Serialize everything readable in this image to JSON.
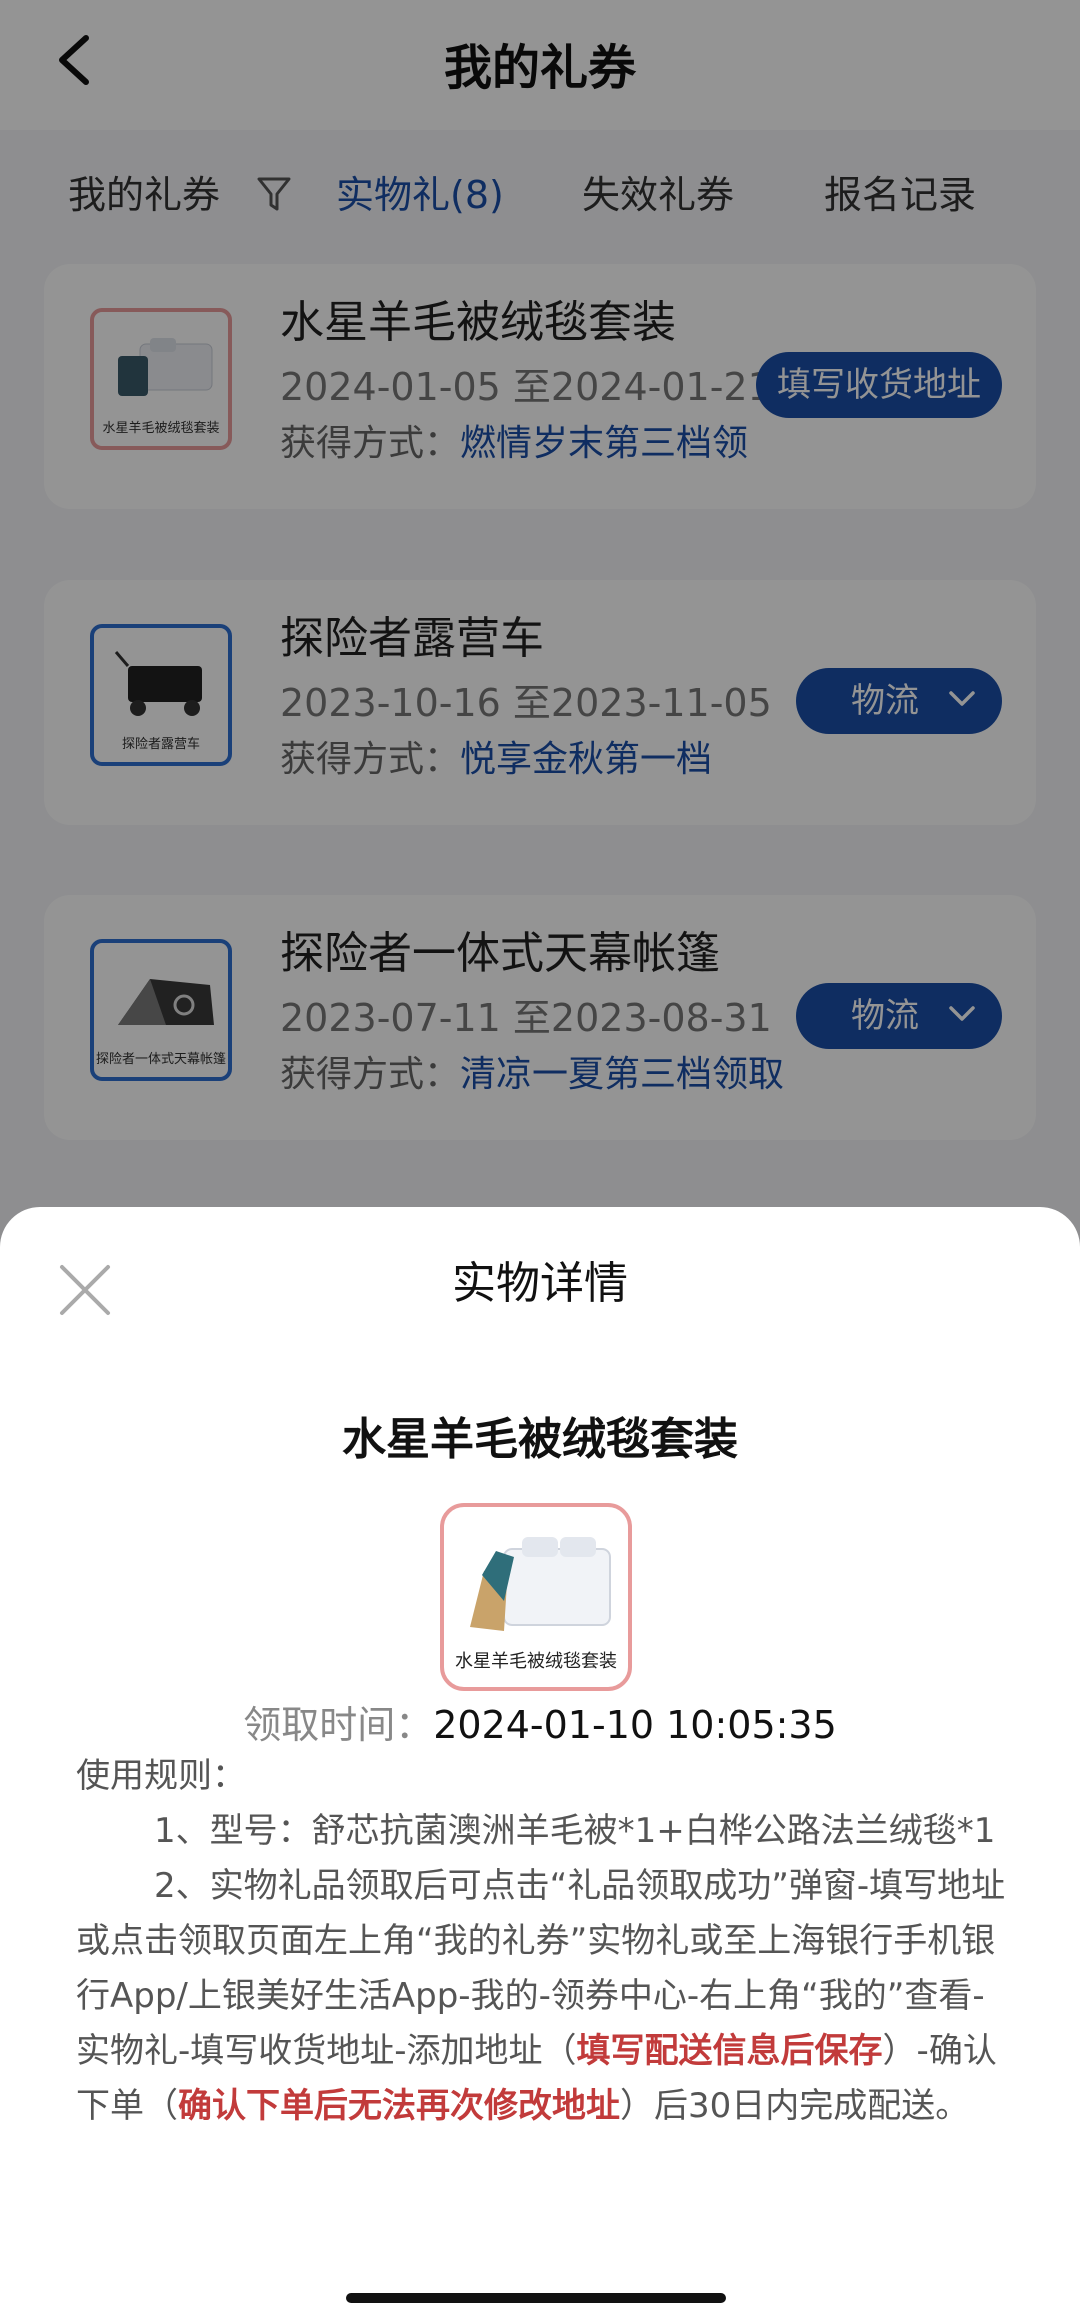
{
  "header": {
    "title": "我的礼券"
  },
  "tabs": [
    {
      "label": "我的礼券"
    },
    {
      "label": "实物礼(8)"
    },
    {
      "label": "失效礼券"
    },
    {
      "label": "报名记录"
    }
  ],
  "cards": [
    {
      "thumb_label": "水星羊毛被绒毯套装",
      "name": "水星羊毛被绒毯套装",
      "dates": "2024-01-05 至2024-01-21",
      "way_label": "获得方式：",
      "way_value": "燃情岁末第三档领",
      "button": "填写收货地址"
    },
    {
      "thumb_label": "探险者露营车",
      "name": "探险者露营车",
      "dates": "2023-10-16 至2023-11-05",
      "way_label": "获得方式：",
      "way_value": "悦享金秋第一档",
      "button": "物流"
    },
    {
      "thumb_label": "探险者一体式天幕帐篷",
      "name": "探险者一体式天幕帐篷",
      "dates": "2023-07-11 至2023-08-31",
      "way_label": "获得方式：",
      "way_value": "清凉一夏第三档领取",
      "button": "物流"
    }
  ],
  "sheet": {
    "title": "实物详情",
    "product_name": "水星羊毛被绒毯套装",
    "image_label": "水星羊毛被绒毯套装",
    "time_label": "领取时间：",
    "time_value": "2024-01-10 10:05:35",
    "rules_title": "使用规则：",
    "rule1": "1、型号：舒芯抗菌澳洲羊毛被*1+白桦公路法兰绒毯*1",
    "rule2_a": "2、实物礼品领取后可点击“礼品领取成功”弹窗-填写地址或点击领取页面左上角“我的礼券”实物礼或至上海银行手机银行App/上银美好生活App-我的-领券中心-右上角“我的”查看-实物礼-填写收货地址-添加地址（",
    "rule2_red1": "填写配送信息后保存",
    "rule2_b": "）-确认下单（",
    "rule2_red2": "确认下单后无法再次修改地址",
    "rule2_c": "）后30日内完成配送。"
  },
  "colors": {
    "accent": "#1a4fa8",
    "warning": "#c23b3b"
  },
  "icons": [
    "back-arrow-icon",
    "filter-icon",
    "chevron-down-icon",
    "close-icon"
  ]
}
